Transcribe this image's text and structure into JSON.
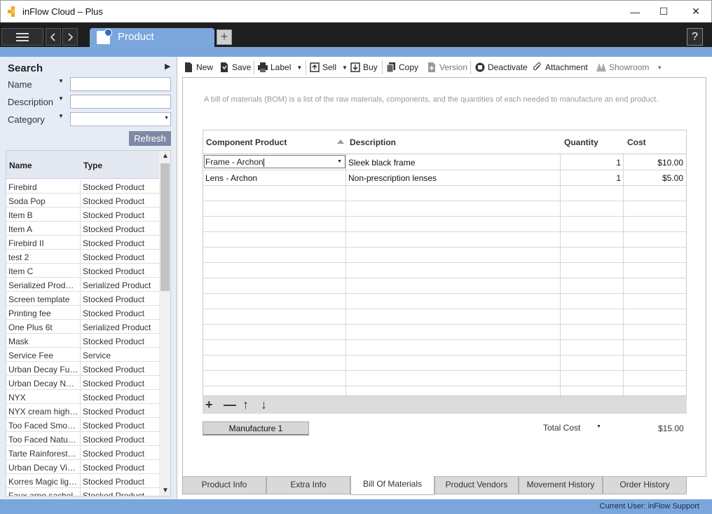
{
  "window": {
    "title": "inFlow Cloud – Plus",
    "minimize": "—",
    "maximize": "☐",
    "close": "✕"
  },
  "tabbar": {
    "active_tab": "Product",
    "add_tab": "+",
    "help": "?"
  },
  "search": {
    "title": "Search",
    "name_label": "Name",
    "description_label": "Description",
    "category_label": "Category",
    "name_value": "",
    "description_value": "",
    "category_value": "",
    "refresh_label": "Refresh"
  },
  "product_list": {
    "columns": [
      "Name",
      "Type"
    ],
    "rows": [
      {
        "name": "Firebird",
        "type": "Stocked Product"
      },
      {
        "name": "Soda Pop",
        "type": "Stocked Product"
      },
      {
        "name": "Item B",
        "type": "Stocked Product"
      },
      {
        "name": "Item A",
        "type": "Stocked Product"
      },
      {
        "name": "Firebird II",
        "type": "Stocked Product"
      },
      {
        "name": "test 2",
        "type": "Stocked Product"
      },
      {
        "name": "Item C",
        "type": "Stocked Product"
      },
      {
        "name": "Serialized Product 1",
        "type": "Serialized Product"
      },
      {
        "name": "Screen template",
        "type": "Stocked Product"
      },
      {
        "name": "Printing fee",
        "type": "Stocked Product"
      },
      {
        "name": "One Plus 6t",
        "type": "Serialized Product"
      },
      {
        "name": "Mask",
        "type": "Stocked Product"
      },
      {
        "name": "Service Fee",
        "type": "Service"
      },
      {
        "name": "Urban Decay Full ...",
        "type": "Stocked Product"
      },
      {
        "name": "Urban Decay Nak...",
        "type": "Stocked Product"
      },
      {
        "name": "NYX",
        "type": "Stocked Product"
      },
      {
        "name": "NYX cream highlig...",
        "type": "Stocked Product"
      },
      {
        "name": "Too Faced Smoke...",
        "type": "Stocked Product"
      },
      {
        "name": "Too Faced Natura...",
        "type": "Stocked Product"
      },
      {
        "name": "Tarte Rainforest of...",
        "type": "Stocked Product"
      },
      {
        "name": "Urban Decay Vice...",
        "type": "Stocked Product"
      },
      {
        "name": "Korres Magic light...",
        "type": "Stocked Product"
      },
      {
        "name": "Faux arno sachel",
        "type": "Stocked Product"
      }
    ]
  },
  "toolbar": {
    "new": "New",
    "save": "Save",
    "label": "Label",
    "sell": "Sell",
    "buy": "Buy",
    "copy": "Copy",
    "version": "Version",
    "deactivate": "Deactivate",
    "attachment": "Attachment",
    "showroom": "Showroom"
  },
  "bom": {
    "info": "A bill of materials (BOM) is a list of the raw materials, components, and the quantities of each needed to manufacture an end product.",
    "columns": {
      "component": "Component Product",
      "description": "Description",
      "quantity": "Quantity",
      "cost": "Cost"
    },
    "rows": [
      {
        "component": "Frame - Archon",
        "description": "Sleek black frame",
        "quantity": "1",
        "cost": "$10.00"
      },
      {
        "component": "Lens - Archon",
        "description": "Non-prescription lenses",
        "quantity": "1",
        "cost": "$5.00"
      }
    ],
    "manufacture_label": "Manufacture 1",
    "total_cost_label": "Total Cost",
    "total_cost_value": "$15.00"
  },
  "bottom_tabs": [
    {
      "label": "Product Info",
      "active": false
    },
    {
      "label": "Extra Info",
      "active": false
    },
    {
      "label": "Bill Of Materials",
      "active": true
    },
    {
      "label": "Product Vendors",
      "active": false
    },
    {
      "label": "Movement History",
      "active": false
    },
    {
      "label": "Order History",
      "active": false
    }
  ],
  "status": {
    "current_user": "Current User:  inFlow Support"
  },
  "colors": {
    "accent_blue": "#7ba6dc",
    "tab_bar": "#1e1e1e",
    "panel_bg": "#e6ecf5"
  }
}
